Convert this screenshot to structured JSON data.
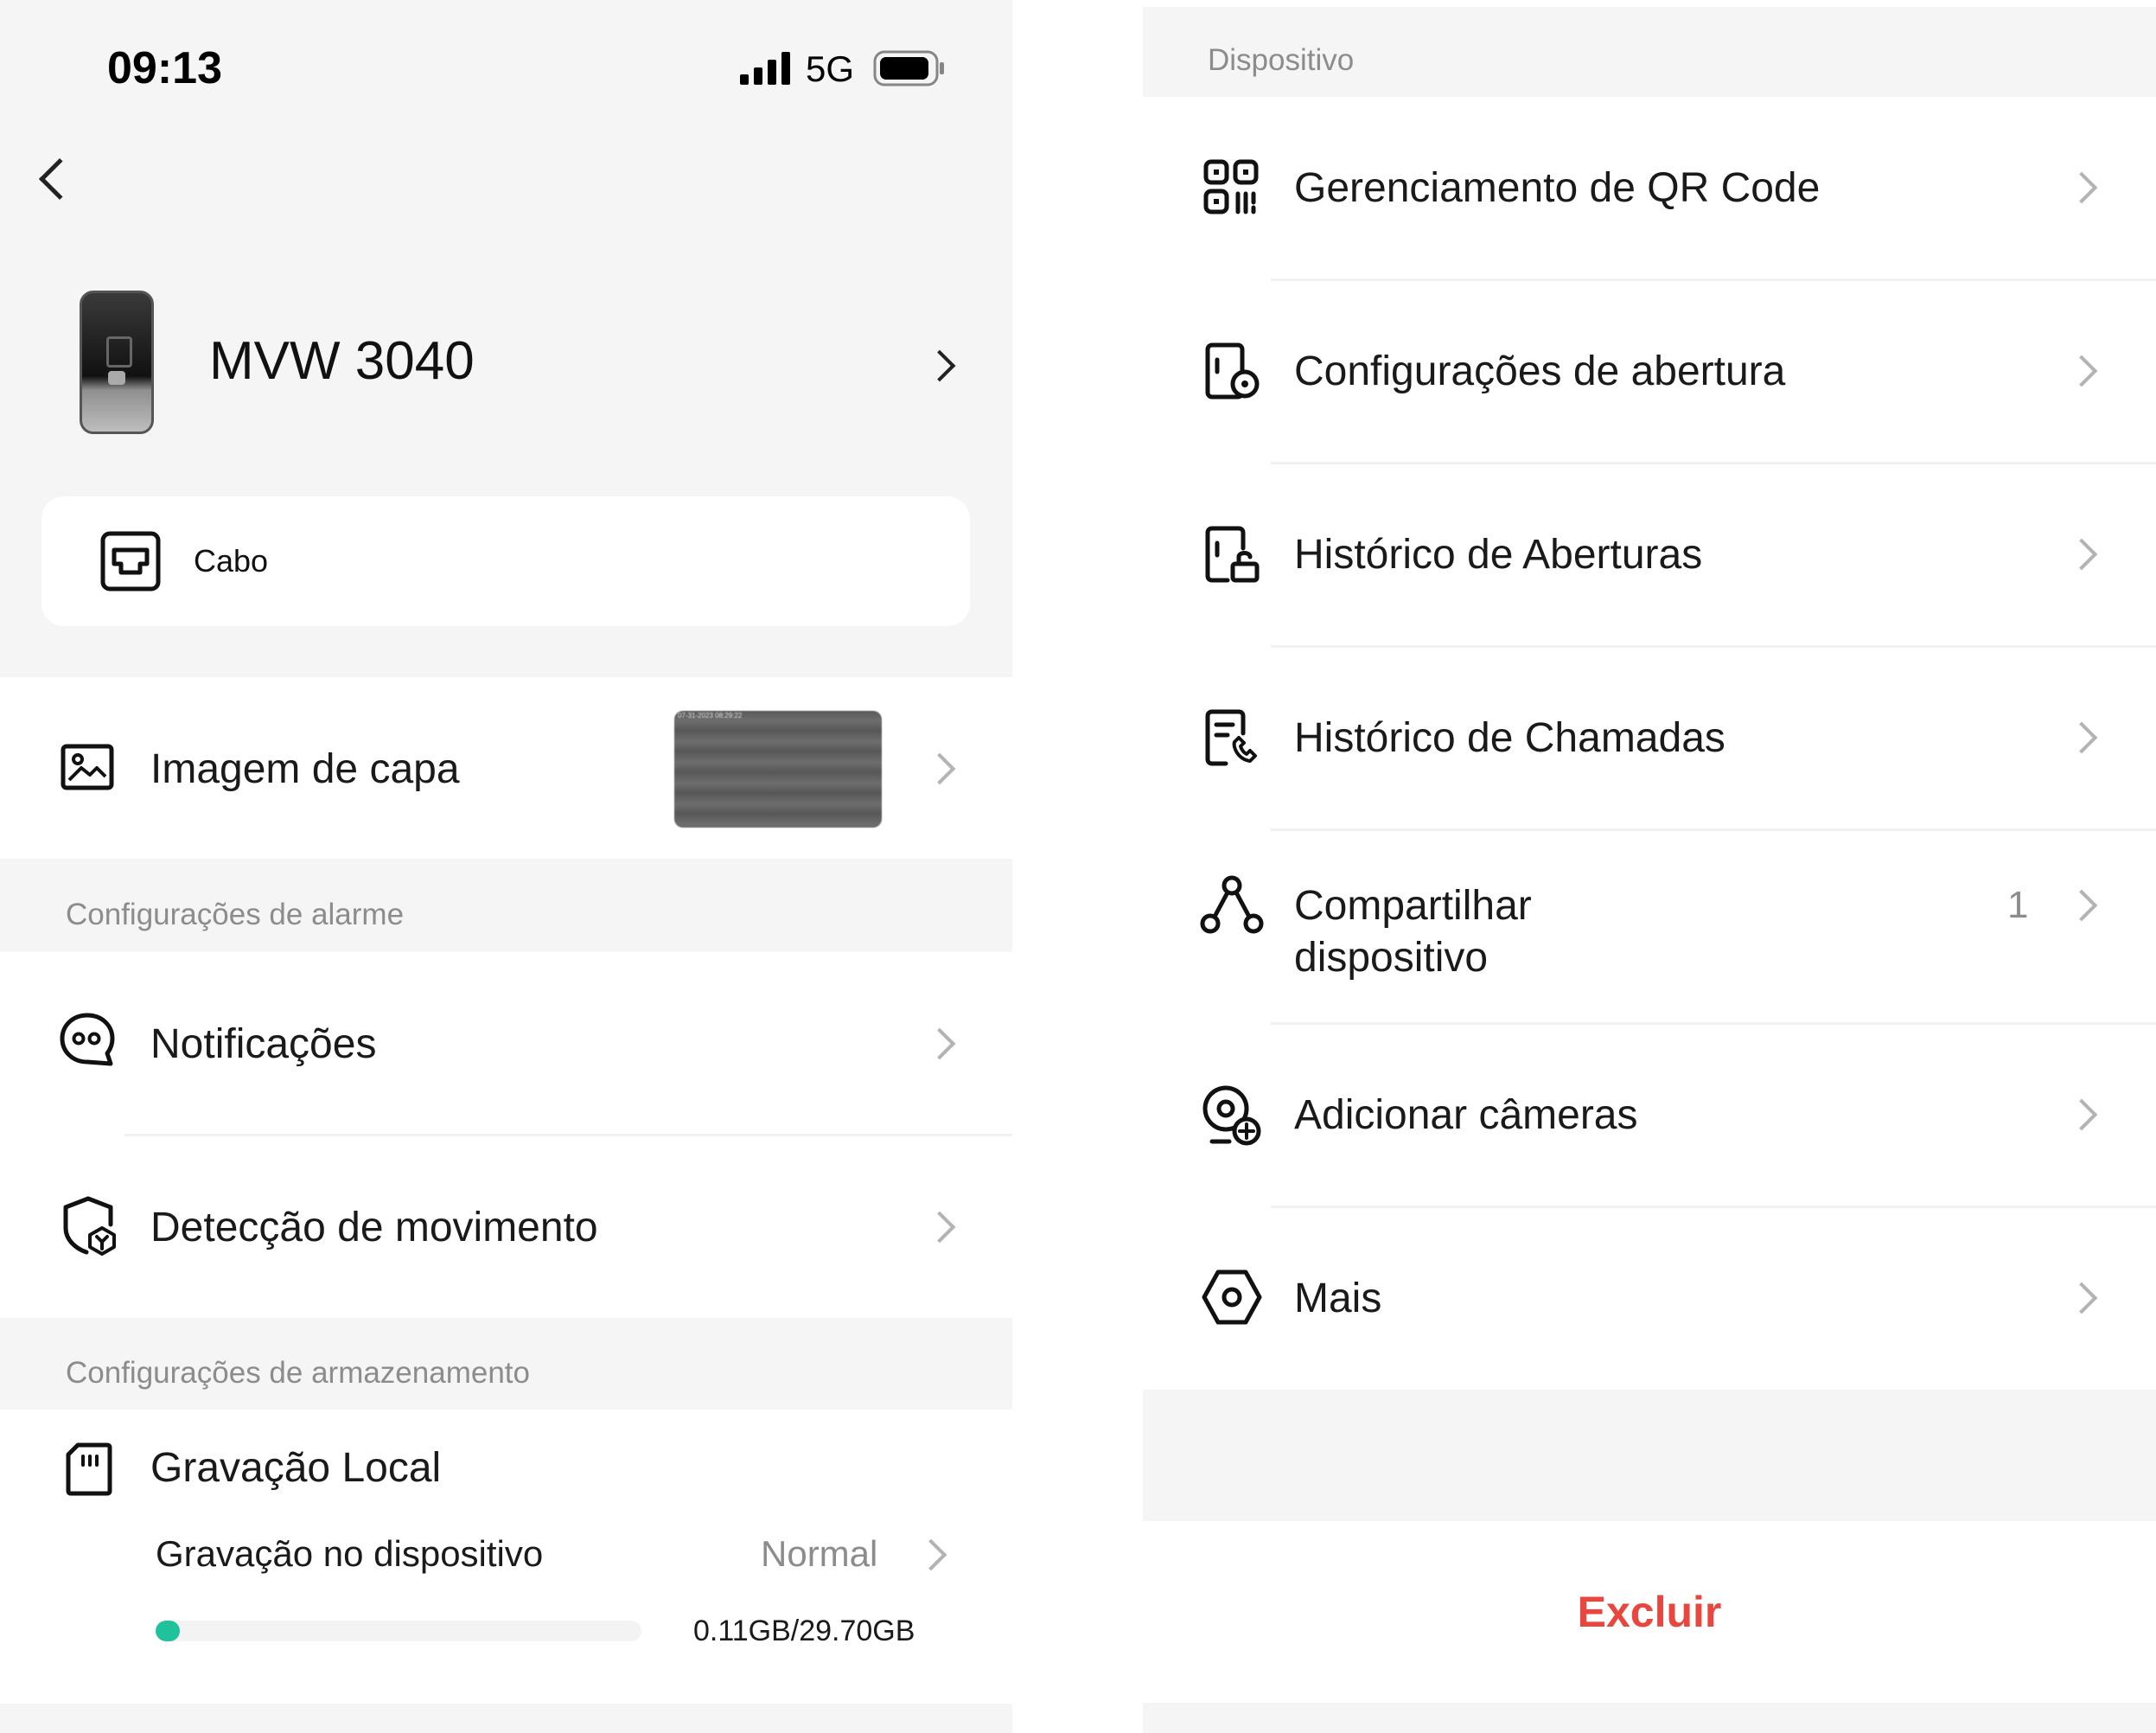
{
  "status_bar": {
    "time": "09:13",
    "network": "5G"
  },
  "device": {
    "name": "MVW 3040"
  },
  "connection": {
    "label": "Cabo"
  },
  "cover_row": {
    "label": "Imagem de capa",
    "thumbnail_caption": "07-31-2023 08:29:22"
  },
  "alarm_section": {
    "header": "Configurações de alarme",
    "items": [
      {
        "label": "Notificações"
      },
      {
        "label": "Detecção de movimento"
      }
    ]
  },
  "storage_section": {
    "header": "Configurações de armazenamento",
    "title": "Gravação Local",
    "device_recording": {
      "label": "Gravação no dispositivo",
      "status": "Normal"
    },
    "usage": {
      "text": "0.11GB/29.70GB",
      "used_gb": 0.11,
      "total_gb": 29.7
    }
  },
  "device_section": {
    "header": "Dispositivo",
    "items": [
      {
        "label": "Gerenciamento de QR Code",
        "icon": "qr-code-icon"
      },
      {
        "label": "Configurações de abertura",
        "icon": "door-open-icon"
      },
      {
        "label": "Histórico de Aberturas",
        "icon": "unlock-history-icon"
      },
      {
        "label": "Histórico de Chamadas",
        "icon": "call-history-icon"
      },
      {
        "label_line1": "Compartilhar",
        "label_line2": "dispositivo",
        "count": "1",
        "icon": "share-icon"
      },
      {
        "label": "Adicionar câmeras",
        "icon": "add-camera-icon"
      },
      {
        "label": "Mais",
        "icon": "hexagon-more-icon"
      }
    ]
  },
  "delete_button": {
    "label": "Excluir"
  },
  "colors": {
    "accent_green": "#1fc29a",
    "danger_red": "#e8463f",
    "background_gray": "#f5f5f5"
  }
}
